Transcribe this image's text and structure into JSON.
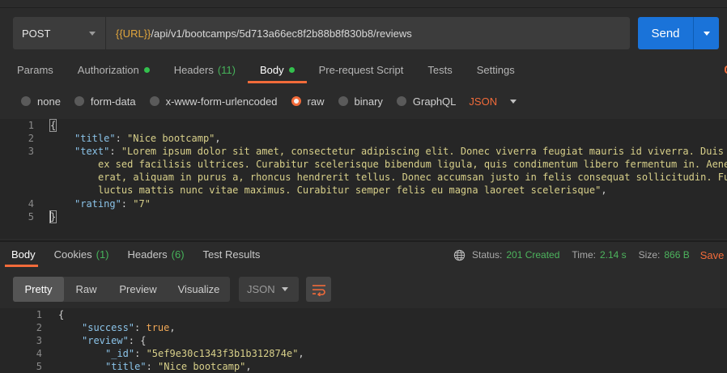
{
  "request": {
    "method": "POST",
    "url_var": "{{URL}}",
    "url_path": "/api/v1/bootcamps/5d713a66ec8f2b88b8f830b8/reviews",
    "send_label": "Send"
  },
  "request_tabs": [
    {
      "label": "Params"
    },
    {
      "label": "Authorization"
    },
    {
      "label": "Headers",
      "count": "(11)"
    },
    {
      "label": "Body"
    },
    {
      "label": "Pre-request Script"
    },
    {
      "label": "Tests"
    },
    {
      "label": "Settings"
    }
  ],
  "body_types": [
    "none",
    "form-data",
    "x-www-form-urlencoded",
    "raw",
    "binary",
    "GraphQL"
  ],
  "body_language": "JSON",
  "request_body": {
    "line_numbers": [
      "1",
      "2",
      "3",
      "",
      "",
      "",
      "4",
      "5"
    ],
    "open_brace": "{",
    "close_brace": "}",
    "title_key": "\"title\"",
    "title_value": "\"Nice bootcamp\"",
    "text_key": "\"text\"",
    "text_line1": "\"Lorem ipsum dolor sit amet, consectetur adipiscing elit. Donec viverra feugiat mauris id viverra. Duis",
    "text_line2": "ex sed facilisis ultrices. Curabitur scelerisque bibendum ligula, quis condimentum libero fermentum in. Aene",
    "text_line3": "erat, aliquam in purus a, rhoncus hendrerit tellus. Donec accumsan justo in felis consequat sollicitudin. Fu",
    "text_line4": "luctus mattis nunc vitae maximus. Curabitur semper felis eu magna laoreet scelerisque\"",
    "rating_key": "\"rating\"",
    "rating_value": "\"7\""
  },
  "response_tabs": [
    {
      "label": "Body"
    },
    {
      "label": "Cookies",
      "count": "(1)"
    },
    {
      "label": "Headers",
      "count": "(6)"
    },
    {
      "label": "Test Results"
    }
  ],
  "response_meta": {
    "status_label": "Status:",
    "status_value": "201 Created",
    "time_label": "Time:",
    "time_value": "2.14 s",
    "size_label": "Size:",
    "size_value": "866 B",
    "save_label": "Save"
  },
  "response_views": [
    "Pretty",
    "Raw",
    "Preview",
    "Visualize"
  ],
  "response_format": "JSON",
  "response_body": {
    "line_numbers": [
      "1",
      "2",
      "3",
      "4",
      "5"
    ],
    "open_brace": "{",
    "success_key": "\"success\"",
    "success_value": "true",
    "review_key": "\"review\"",
    "id_key": "\"_id\"",
    "id_value": "\"5ef9e30c1343f3b1b312874e\"",
    "title_key": "\"title\"",
    "title_value": "\"Nice bootcamp\""
  },
  "colors": {
    "accent": "#f26b3a",
    "send_button": "#1a73d9",
    "success_green": "#4db45d"
  }
}
